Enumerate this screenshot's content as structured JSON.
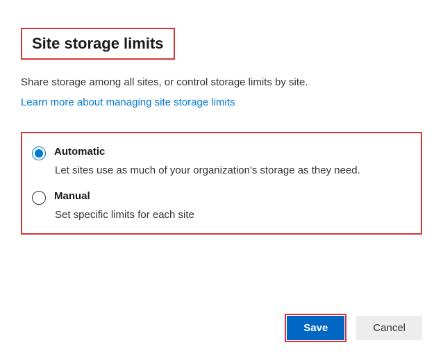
{
  "header": {
    "title": "Site storage limits"
  },
  "intro": {
    "description": "Share storage among all sites, or control storage limits by site.",
    "learn_link": "Learn more about managing site storage limits"
  },
  "options": {
    "automatic": {
      "label": "Automatic",
      "description": "Let sites use as much of your organization's storage as they need.",
      "selected": true
    },
    "manual": {
      "label": "Manual",
      "description": "Set specific limits for each site",
      "selected": false
    }
  },
  "buttons": {
    "save": "Save",
    "cancel": "Cancel"
  }
}
